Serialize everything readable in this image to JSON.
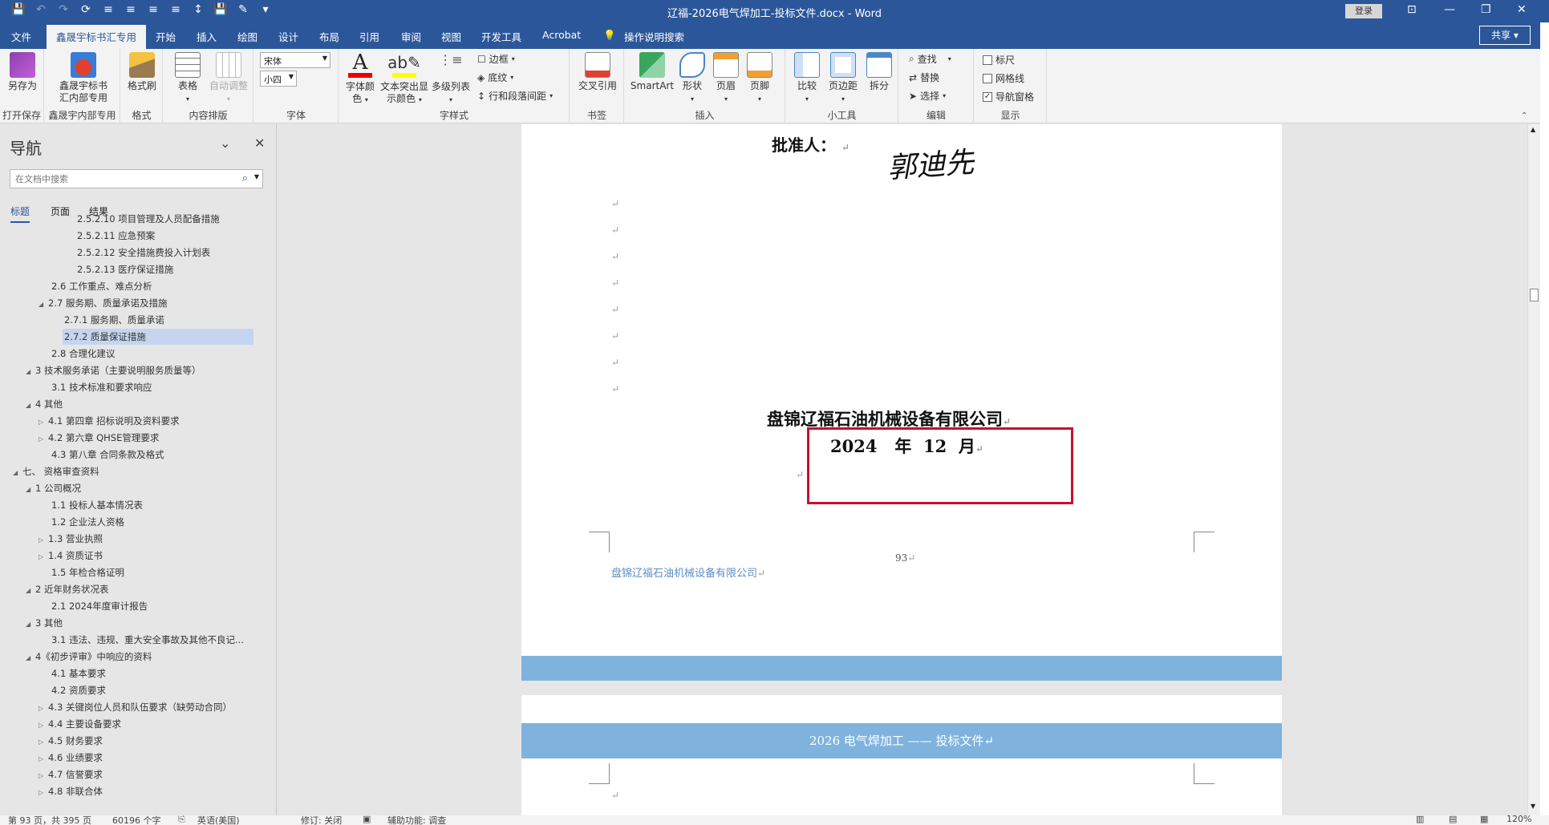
{
  "window": {
    "title": "辽福-2026电气焊加工-投标文件.docx  -  Word",
    "login": "登录",
    "share": "共享"
  },
  "qat": [
    "💾",
    "↶",
    "↷",
    "⟳",
    "≡",
    "≡",
    "≡",
    "≡",
    "↕",
    "💾",
    "✎",
    "▾"
  ],
  "tabs": [
    "文件",
    "鑫晟宇标书汇专用",
    "开始",
    "插入",
    "绘图",
    "设计",
    "布局",
    "引用",
    "审阅",
    "视图",
    "开发工具",
    "Acrobat",
    "操作说明搜索"
  ],
  "ribbon": {
    "save_as": "另存为",
    "group_open_save": "打开保存",
    "xsy_label1": "鑫晟宇标书",
    "xsy_label2": "汇内部专用",
    "group_xsy": "鑫晟宇内部专用",
    "format_painter": "格式刷",
    "group_format": "格式",
    "table": "表格",
    "auto_adjust": "自动调整",
    "group_layout": "内容排版",
    "font_name": "宋体",
    "font_size": "小四",
    "group_font": "字体",
    "font_color1": "字体颜",
    "font_color2": "色",
    "highlight1": "文本突出显",
    "highlight2": "示颜色",
    "multilevel": "多级列表",
    "border": "边框",
    "shading": "底纹",
    "line_spacing": "行和段落间距",
    "group_style": "字样式",
    "cross_ref": "交叉引用",
    "group_bookmark": "书签",
    "smartart": "SmartArt",
    "shape": "形状",
    "header": "页眉",
    "footer": "页脚",
    "group_insert": "插入",
    "compare": "比较",
    "margins": "页边距",
    "split": "拆分",
    "group_tools": "小工具",
    "find": "查找",
    "replace": "替换",
    "select": "选择",
    "group_edit": "编辑",
    "ruler": "标尺",
    "gridlines": "网格线",
    "nav_pane": "导航窗格",
    "group_show": "显示"
  },
  "nav": {
    "title": "导航",
    "search_placeholder": "在文档中搜索",
    "tabs": [
      "标题",
      "页面",
      "结果"
    ],
    "items": [
      "2.5.2.10 项目管理及人员配备措施",
      "2.5.2.11 应急预案",
      "2.5.2.12 安全措施费投入计划表",
      "2.5.2.13 医疗保证措施",
      "2.6 工作重点、难点分析",
      "2.7 服务期、质量承诺及措施",
      "2.7.1 服务期、质量承诺",
      "2.7.2 质量保证措施",
      "2.8 合理化建议",
      "3 技术服务承诺（主要说明服务质量等）",
      "3.1 技术标准和要求响应",
      "4 其他",
      "4.1 第四章  招标说明及资料要求",
      "4.2 第六章  QHSE管理要求",
      "4.3 第八章  合同条款及格式",
      "七、 资格审查资料",
      "1 公司概况",
      "1.1 投标人基本情况表",
      "1.2 企业法人资格",
      "1.3 营业执照",
      "1.4 资质证书",
      "1.5 年检合格证明",
      "2 近年财务状况表",
      "2.1 2024年度审计报告",
      "3 其他",
      "3.1 违法、违规、重大安全事故及其他不良记...",
      "4《初步评审》中响应的资料",
      "4.1 基本要求",
      "4.2 资质要求",
      "4.3 关键岗位人员和队伍要求（缺劳动合同）",
      "4.4 主要设备要求",
      "4.5 财务要求",
      "4.6 业绩要求",
      "4.7 信誉要求",
      "4.8 非联合体"
    ]
  },
  "document": {
    "approver_label": "批准人：",
    "signature": "郭迪先",
    "company": "盘锦辽福石油机械设备有限公司",
    "date_line": "2024   年  12  月",
    "page_number": "93",
    "footer_company": "盘锦辽福石油机械设备有限公司",
    "header_next": "2026 电气焊加工  ——  投标文件",
    "para_mark": "↵"
  },
  "status": {
    "page": "第 93 页，共 395 页",
    "words": "60196 个字",
    "lang": "英语(美国)",
    "track": "修订: 关闭",
    "access": "辅助功能: 调查",
    "zoom": "120%"
  },
  "colors": {
    "word_blue": "#2b579a",
    "band_blue": "#7fb3de",
    "red_box": "#c8102e",
    "nav_selected": "#c5d5ef"
  }
}
